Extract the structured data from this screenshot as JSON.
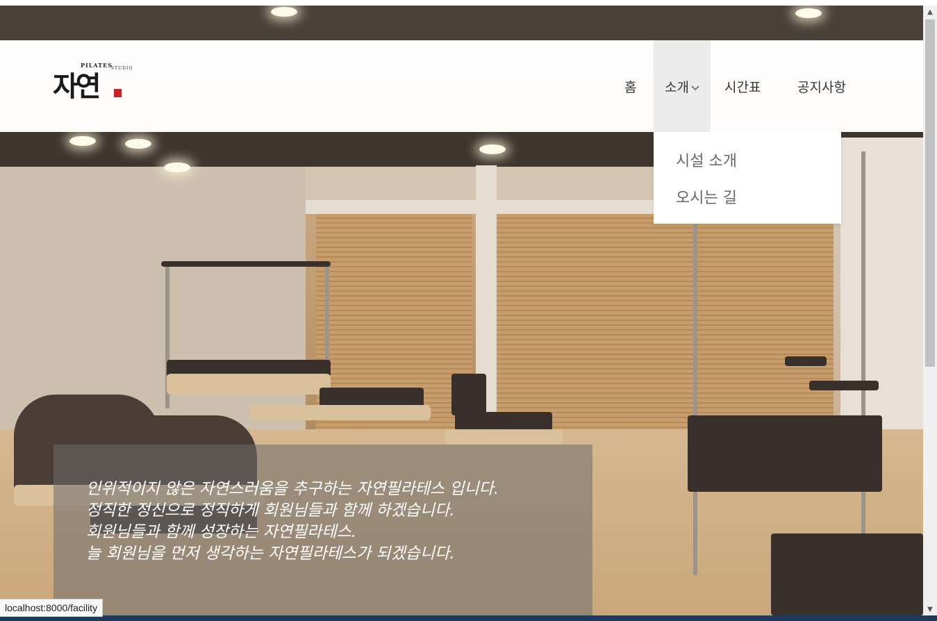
{
  "header": {
    "logo": {
      "main": "자연",
      "pilates": "PILATES",
      "studio": "STUDIO"
    },
    "nav": [
      {
        "label": "홈"
      },
      {
        "label": "소개",
        "icon": "chevron-down-icon"
      },
      {
        "label": "시간표"
      },
      {
        "label": "공지사항"
      }
    ]
  },
  "dropdown": {
    "items": [
      {
        "label": "시설 소개"
      },
      {
        "label": "오시는 길"
      }
    ]
  },
  "hero": {
    "caption": [
      "인위적이지 않은 자연스러움을 추구하는 자연필라테스 입니다.",
      "정직한 정신으로 정직하게 회원님들과 함께 하겠습니다.",
      "회원님들과 함께 성장하는 자연필라테스.",
      "늘 회원님을 먼저 생각하는 자연필라테스가 되겠습니다."
    ]
  },
  "status_bar": {
    "url": "localhost:8000/facility"
  },
  "colors": {
    "accent_seal": "#c8252a",
    "caption_bg": "#6e6e6e",
    "nav_active_bg": "#ececec"
  }
}
